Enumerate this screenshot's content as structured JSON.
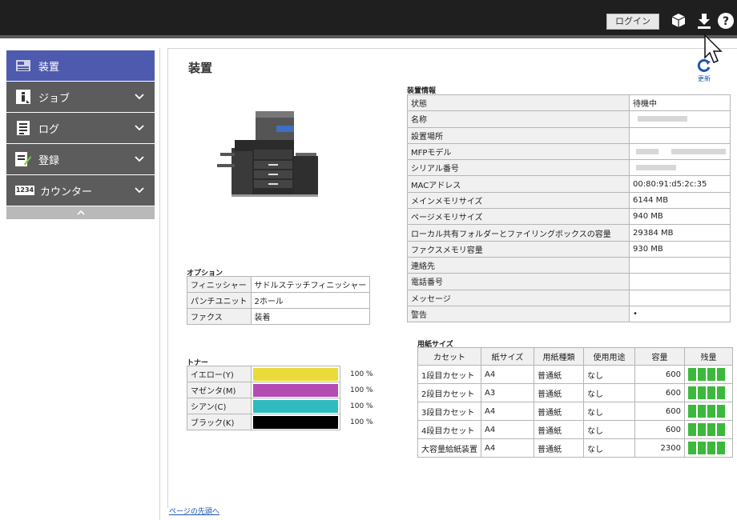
{
  "topbar": {
    "login_label": "ログイン",
    "icons": [
      "box-icon",
      "download-icon",
      "help-icon"
    ]
  },
  "sidebar": {
    "items": [
      {
        "label": "装置",
        "icon": "device-icon",
        "active": true
      },
      {
        "label": "ジョブ",
        "icon": "info-icon"
      },
      {
        "label": "ログ",
        "icon": "log-icon"
      },
      {
        "label": "登録",
        "icon": "register-icon"
      },
      {
        "label": "カウンター",
        "icon": "counter-icon",
        "icon_text": "1234"
      }
    ]
  },
  "main": {
    "title": "装置",
    "refresh_label": "更新"
  },
  "options": {
    "title": "オプション",
    "rows": [
      {
        "label": "フィニッシャー",
        "value": "サドルステッチフィニッシャー"
      },
      {
        "label": "パンチユニット",
        "value": "2ホール"
      },
      {
        "label": "ファクス",
        "value": "装着"
      }
    ]
  },
  "toner": {
    "title": "トナー",
    "rows": [
      {
        "label": "イエロー(Y)",
        "percent": "100 %",
        "color": "#eadb3b",
        "level": 1.0
      },
      {
        "label": "マゼンタ(M)",
        "percent": "100 %",
        "color": "#b34bb2",
        "level": 1.0
      },
      {
        "label": "シアン(C)",
        "percent": "100 %",
        "color": "#2ebcc0",
        "level": 1.0
      },
      {
        "label": "ブラック(K)",
        "percent": "100 %",
        "color": "#000000",
        "level": 1.0
      }
    ]
  },
  "device_info": {
    "title": "装置情報",
    "rows": [
      {
        "label": "状態",
        "value": "待機中"
      },
      {
        "label": "名称",
        "value": ""
      },
      {
        "label": "設置場所",
        "value": ""
      },
      {
        "label": "MFPモデル",
        "value": ""
      },
      {
        "label": "シリアル番号",
        "value": ""
      },
      {
        "label": "MACアドレス",
        "value": "00:80:91:d5:2c:35"
      },
      {
        "label": "メインメモリサイズ",
        "value": "6144 MB"
      },
      {
        "label": "ページメモリサイズ",
        "value": "940 MB"
      },
      {
        "label": "ローカル共有フォルダーとファイリングボックスの容量",
        "value": "29384 MB"
      },
      {
        "label": "ファクスメモリ容量",
        "value": "930 MB"
      },
      {
        "label": "連絡先",
        "value": ""
      },
      {
        "label": "電話番号",
        "value": ""
      },
      {
        "label": "メッセージ",
        "value": ""
      },
      {
        "label": "警告",
        "value": "•"
      }
    ]
  },
  "paper": {
    "title": "用紙サイズ",
    "headers": [
      "カセット",
      "紙サイズ",
      "用紙種類",
      "使用用途",
      "容量",
      "残量"
    ],
    "rows": [
      {
        "cassette": "1段目カセット",
        "size": "A4",
        "type": "普通紙",
        "use": "なし",
        "capacity": "600",
        "level": 4
      },
      {
        "cassette": "2段目カセット",
        "size": "A3",
        "type": "普通紙",
        "use": "なし",
        "capacity": "600",
        "level": 4
      },
      {
        "cassette": "3段目カセット",
        "size": "A4",
        "type": "普通紙",
        "use": "なし",
        "capacity": "600",
        "level": 4
      },
      {
        "cassette": "4段目カセット",
        "size": "A4",
        "type": "普通紙",
        "use": "なし",
        "capacity": "600",
        "level": 4
      },
      {
        "cassette": "大容量給紙装置",
        "size": "A4",
        "type": "普通紙",
        "use": "なし",
        "capacity": "2300",
        "level": 4
      }
    ]
  },
  "footer": {
    "top_link": "ページの先頭へ"
  }
}
